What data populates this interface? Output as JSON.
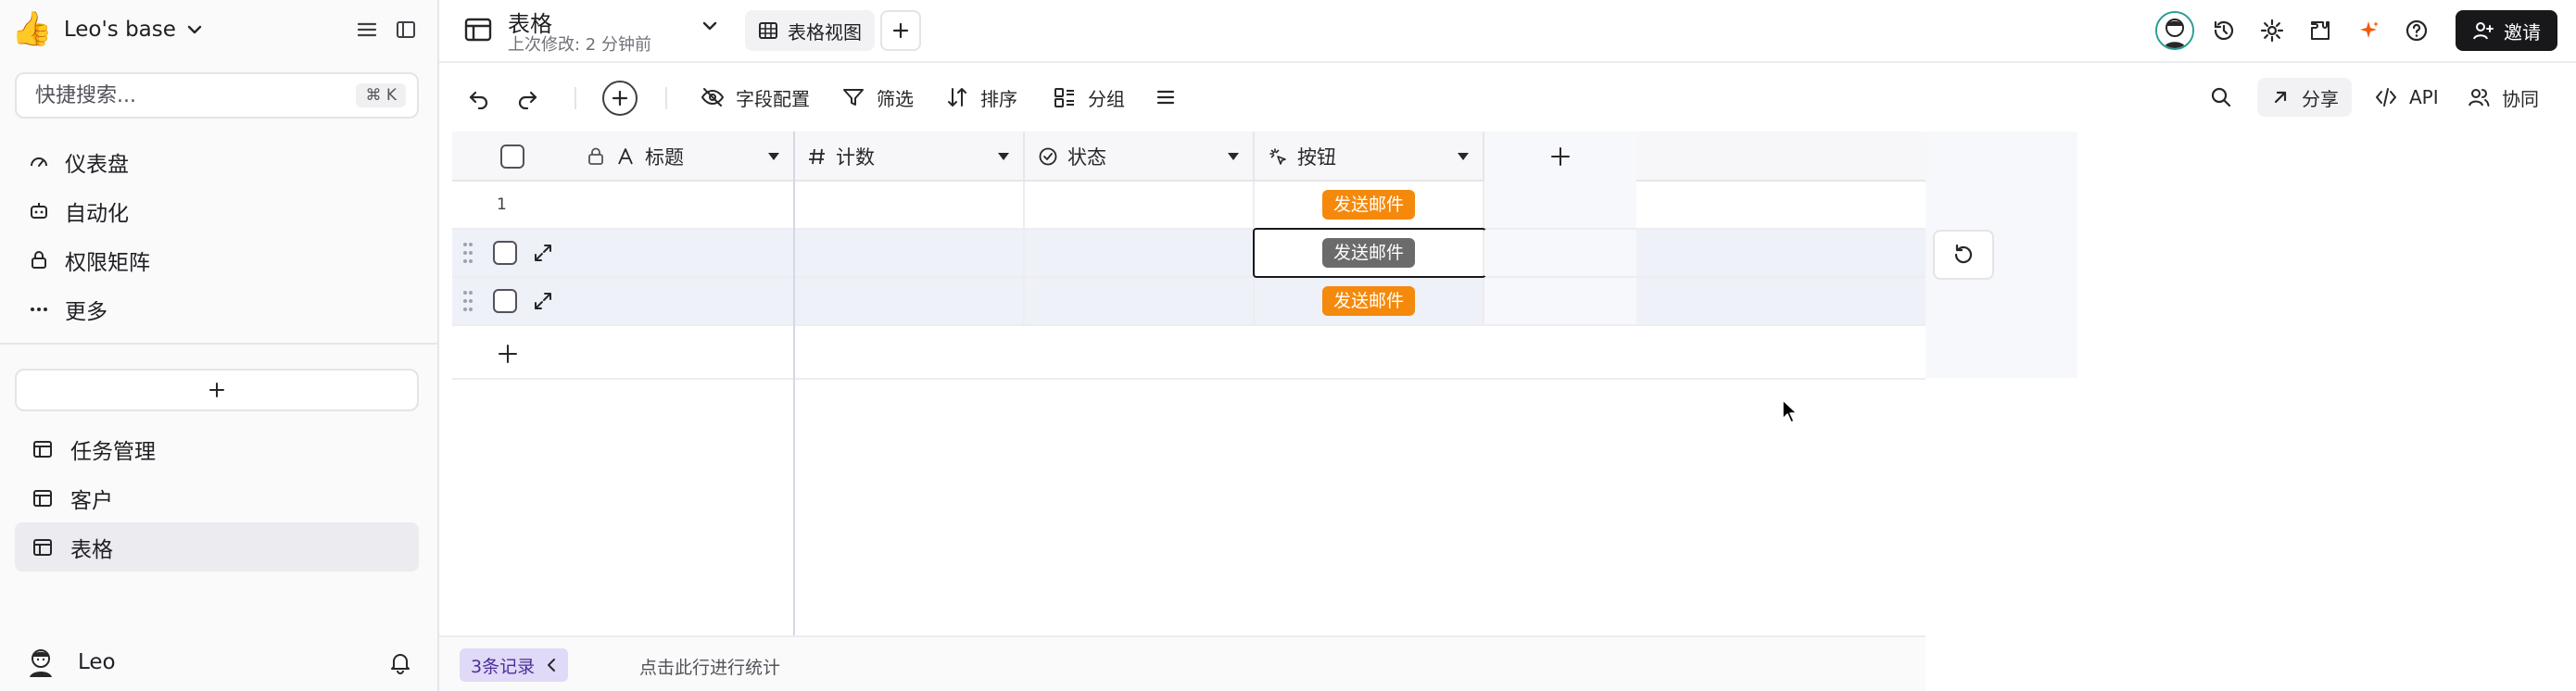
{
  "sidebar": {
    "workspace_name": "Leo's base",
    "search_placeholder": "快捷搜索...",
    "search_shortcut": "⌘ K",
    "nav": [
      {
        "label": "仪表盘",
        "icon": "gauge-icon"
      },
      {
        "label": "自动化",
        "icon": "robot-icon"
      },
      {
        "label": "权限矩阵",
        "icon": "lock-icon"
      },
      {
        "label": "更多",
        "icon": "more-dots-icon"
      }
    ],
    "add_label": "+",
    "tables": [
      {
        "label": "任务管理",
        "icon": "table-icon"
      },
      {
        "label": "客户",
        "icon": "table-icon"
      },
      {
        "label": "表格",
        "icon": "table-icon",
        "active": true
      }
    ],
    "user_name": "Leo"
  },
  "topbar": {
    "title": "表格",
    "subtitle": "上次修改: 2 分钟前",
    "view_tab": "表格视图",
    "invite_label": "邀请"
  },
  "toolbar": {
    "field_config": "字段配置",
    "filter": "筛选",
    "sort": "排序",
    "group": "分组",
    "share": "分享",
    "api": "API",
    "collab": "协同"
  },
  "grid": {
    "columns": [
      {
        "label": "标题",
        "icon": "text-field-icon"
      },
      {
        "label": "计数",
        "icon": "number-field-icon"
      },
      {
        "label": "状态",
        "icon": "status-field-icon"
      },
      {
        "label": "按钮",
        "icon": "button-field-icon"
      }
    ],
    "rows": [
      {
        "number": "1",
        "button_label": "发送邮件",
        "state": "normal"
      },
      {
        "number": "",
        "button_label": "发送邮件",
        "state": "pressed"
      },
      {
        "number": "",
        "button_label": "发送邮件",
        "state": "normal"
      }
    ],
    "record_count": "3条记录",
    "stats_hint": "点击此行进行统计"
  },
  "colors": {
    "button_orange": "#f5890c",
    "button_pressed": "#6b6b6b",
    "invite_bg": "#18181b",
    "record_badge_bg": "#e0d9f7"
  }
}
